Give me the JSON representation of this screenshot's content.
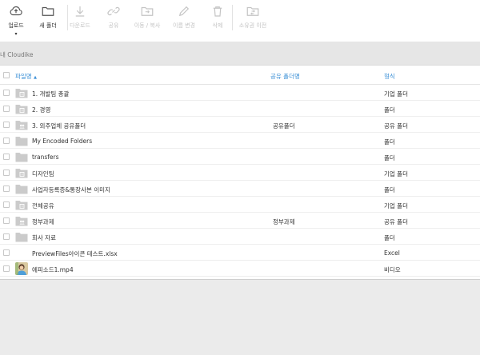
{
  "toolbar": {
    "upload": {
      "label": "업로드",
      "icon": "cloud-upload-icon"
    },
    "new_folder": {
      "label": "새 폴더",
      "icon": "folder-icon"
    },
    "download": {
      "label": "다운로드",
      "icon": "download-icon"
    },
    "share": {
      "label": "공유",
      "icon": "link-icon"
    },
    "move_copy": {
      "label": "이동 / 복사",
      "icon": "folder-move-icon"
    },
    "rename": {
      "label": "이름 변경",
      "icon": "pencil-icon"
    },
    "delete": {
      "label": "삭제",
      "icon": "trash-icon"
    },
    "transfer_owner": {
      "label": "소유권 이전",
      "icon": "transfer-ownership-icon"
    }
  },
  "breadcrumb": {
    "path": "내 Cloudike"
  },
  "table": {
    "headers": {
      "name": "파일명",
      "shared_folder": "공유 폴더명",
      "type": "형식"
    },
    "sort_indicator": "▲",
    "rows": [
      {
        "name": "1. 개발팀 총괄",
        "shared": "",
        "type": "기업 폴더",
        "icon": "company-folder-icon"
      },
      {
        "name": "2. 경영",
        "shared": "",
        "type": "폴더",
        "icon": "company-folder-icon"
      },
      {
        "name": "3. 외주업체 공유폴더",
        "shared": "공유폴더",
        "type": "공유 폴더",
        "icon": "shared-folder-icon"
      },
      {
        "name": "My Encoded Folders",
        "shared": "",
        "type": "폴더",
        "icon": "folder-icon"
      },
      {
        "name": "transfers",
        "shared": "",
        "type": "폴더",
        "icon": "folder-icon"
      },
      {
        "name": "디자인팀",
        "shared": "",
        "type": "기업 폴더",
        "icon": "company-folder-icon"
      },
      {
        "name": "사업자등록증&통장사본 이미지",
        "shared": "",
        "type": "폴더",
        "icon": "folder-icon"
      },
      {
        "name": "전체공유",
        "shared": "",
        "type": "기업 폴더",
        "icon": "company-folder-icon"
      },
      {
        "name": "정부과제",
        "shared": "정부과제",
        "type": "공유 폴더",
        "icon": "shared-folder-icon"
      },
      {
        "name": "회사 자료",
        "shared": "",
        "type": "폴더",
        "icon": "folder-icon"
      },
      {
        "name": "PreviewFiles아이콘 테스트.xlsx",
        "shared": "",
        "type": "Excel",
        "icon": "none"
      },
      {
        "name": "에피소드1.mp4",
        "shared": "",
        "type": "비디오",
        "icon": "video-thumbnail-icon"
      }
    ]
  },
  "colors": {
    "accent": "#3a8fd6",
    "folder": "#c9c9c9",
    "disabled": "#c4c4c4"
  }
}
